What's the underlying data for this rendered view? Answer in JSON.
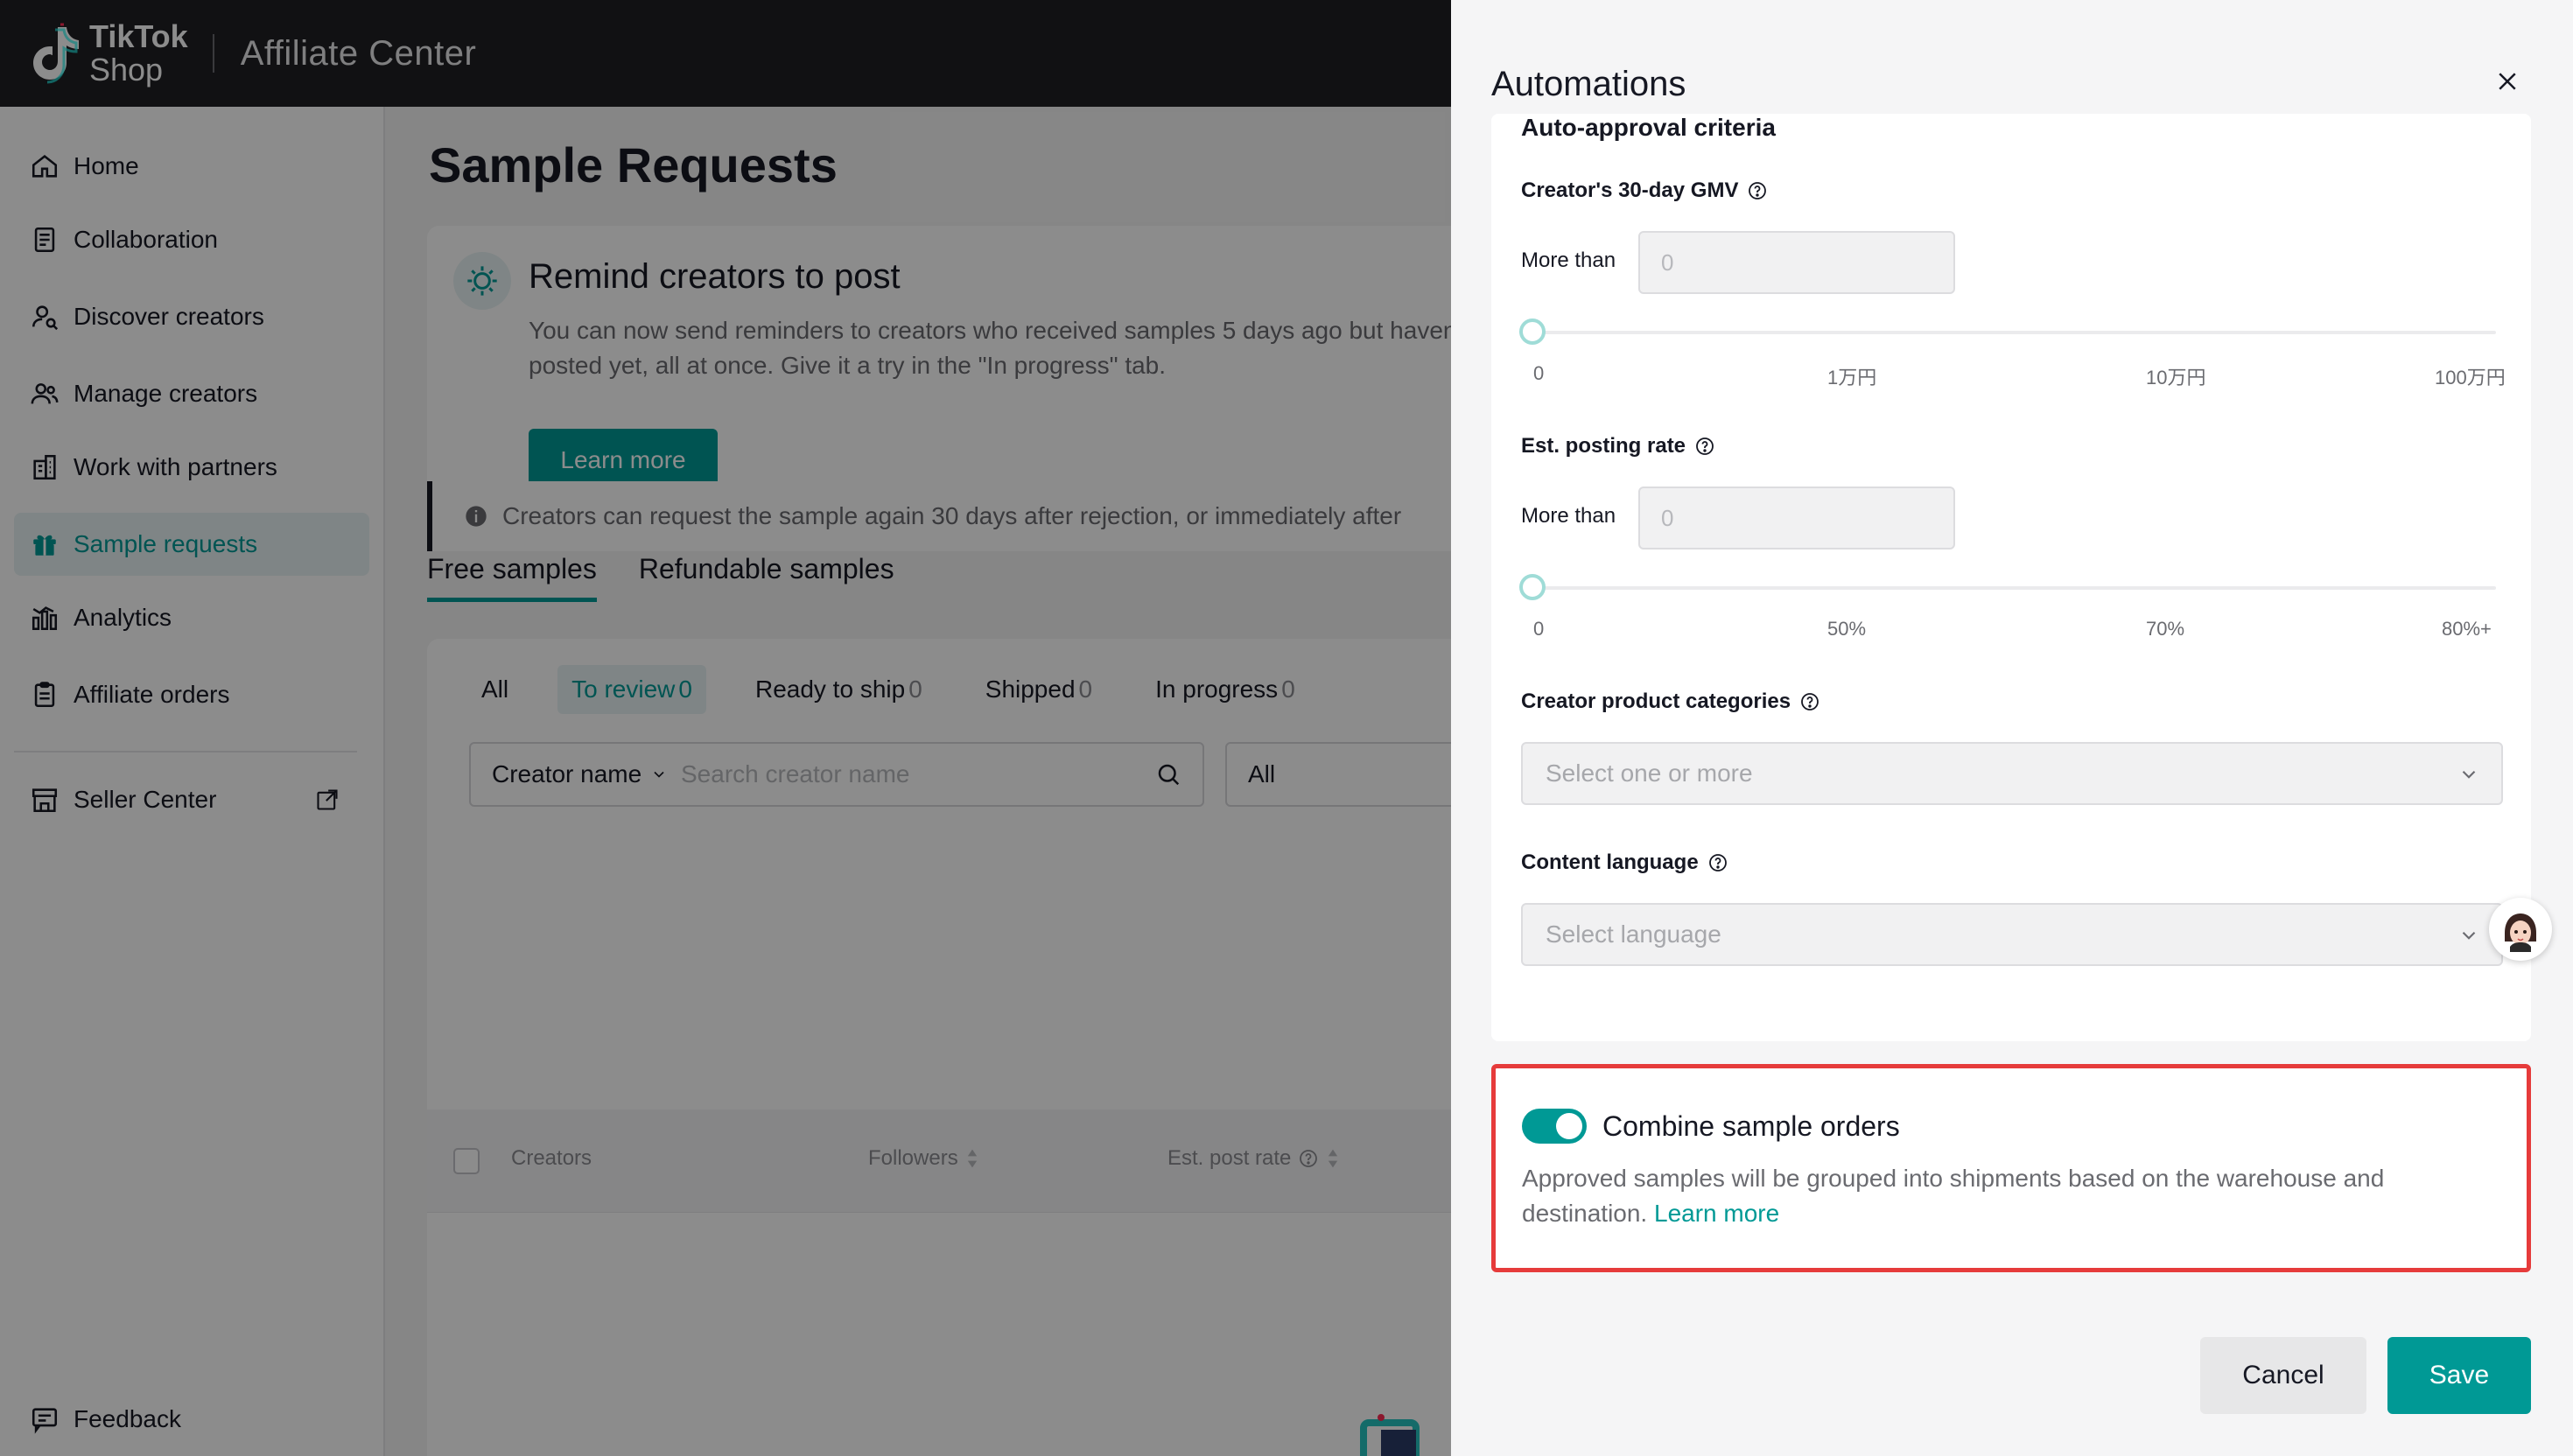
{
  "header": {
    "logo_line1": "TikTok",
    "logo_line2": "Shop",
    "app_title": "Affiliate Center"
  },
  "sidebar": {
    "items": [
      {
        "label": "Home",
        "icon": "home-icon"
      },
      {
        "label": "Collaboration",
        "icon": "document-icon"
      },
      {
        "label": "Discover creators",
        "icon": "person-search-icon"
      },
      {
        "label": "Manage creators",
        "icon": "people-icon"
      },
      {
        "label": "Work with partners",
        "icon": "building-icon"
      },
      {
        "label": "Sample requests",
        "icon": "gift-icon",
        "active": true
      },
      {
        "label": "Analytics",
        "icon": "bar-chart-icon"
      },
      {
        "label": "Affiliate orders",
        "icon": "clipboard-icon"
      }
    ],
    "seller_center": "Seller Center",
    "feedback": "Feedback"
  },
  "main": {
    "page_title": "Sample Requests",
    "remind": {
      "title": "Remind creators to post",
      "desc": "You can now send reminders to creators who received samples 5 days ago but haven't posted yet, all at once. Give it a try in the \"In progress\" tab.",
      "button": "Learn more"
    },
    "tabs": [
      "Free samples",
      "Refundable samples"
    ],
    "status": [
      {
        "label": "All",
        "count": ""
      },
      {
        "label": "To review",
        "count": "0"
      },
      {
        "label": "Ready to ship",
        "count": "0"
      },
      {
        "label": "Shipped",
        "count": "0"
      },
      {
        "label": "In progress",
        "count": "0"
      }
    ],
    "search": {
      "field_select": "Creator name",
      "placeholder": "Search creator name",
      "all_select": "All"
    },
    "info_banner": "Creators can request the sample again 30 days after rejection, or immediately after",
    "table": {
      "columns": [
        "Creators",
        "Followers",
        "Est. post rate"
      ]
    }
  },
  "drawer": {
    "title": "Automations",
    "section_title": "Auto-approval criteria",
    "gmv": {
      "label": "Creator's 30-day GMV",
      "more_than": "More than",
      "value_placeholder": "0",
      "ticks": [
        "0",
        "1万円",
        "10万円",
        "100万円"
      ],
      "slider_value": 0
    },
    "posting_rate": {
      "label": "Est. posting rate",
      "more_than": "More than",
      "value_placeholder": "0",
      "ticks": [
        "0",
        "50%",
        "70%",
        "80%+"
      ],
      "slider_value": 0
    },
    "categories": {
      "label": "Creator product categories",
      "placeholder": "Select one or more"
    },
    "language": {
      "label": "Content language",
      "placeholder": "Select language"
    },
    "combine": {
      "enabled": true,
      "title": "Combine sample orders",
      "desc": "Approved samples will be grouped into shipments based on the warehouse and destination.",
      "link": "Learn more"
    },
    "cancel": "Cancel",
    "save": "Save"
  },
  "colors": {
    "accent": "#009995",
    "highlight_border": "#e63b3b",
    "header_bg": "#1f2024"
  }
}
